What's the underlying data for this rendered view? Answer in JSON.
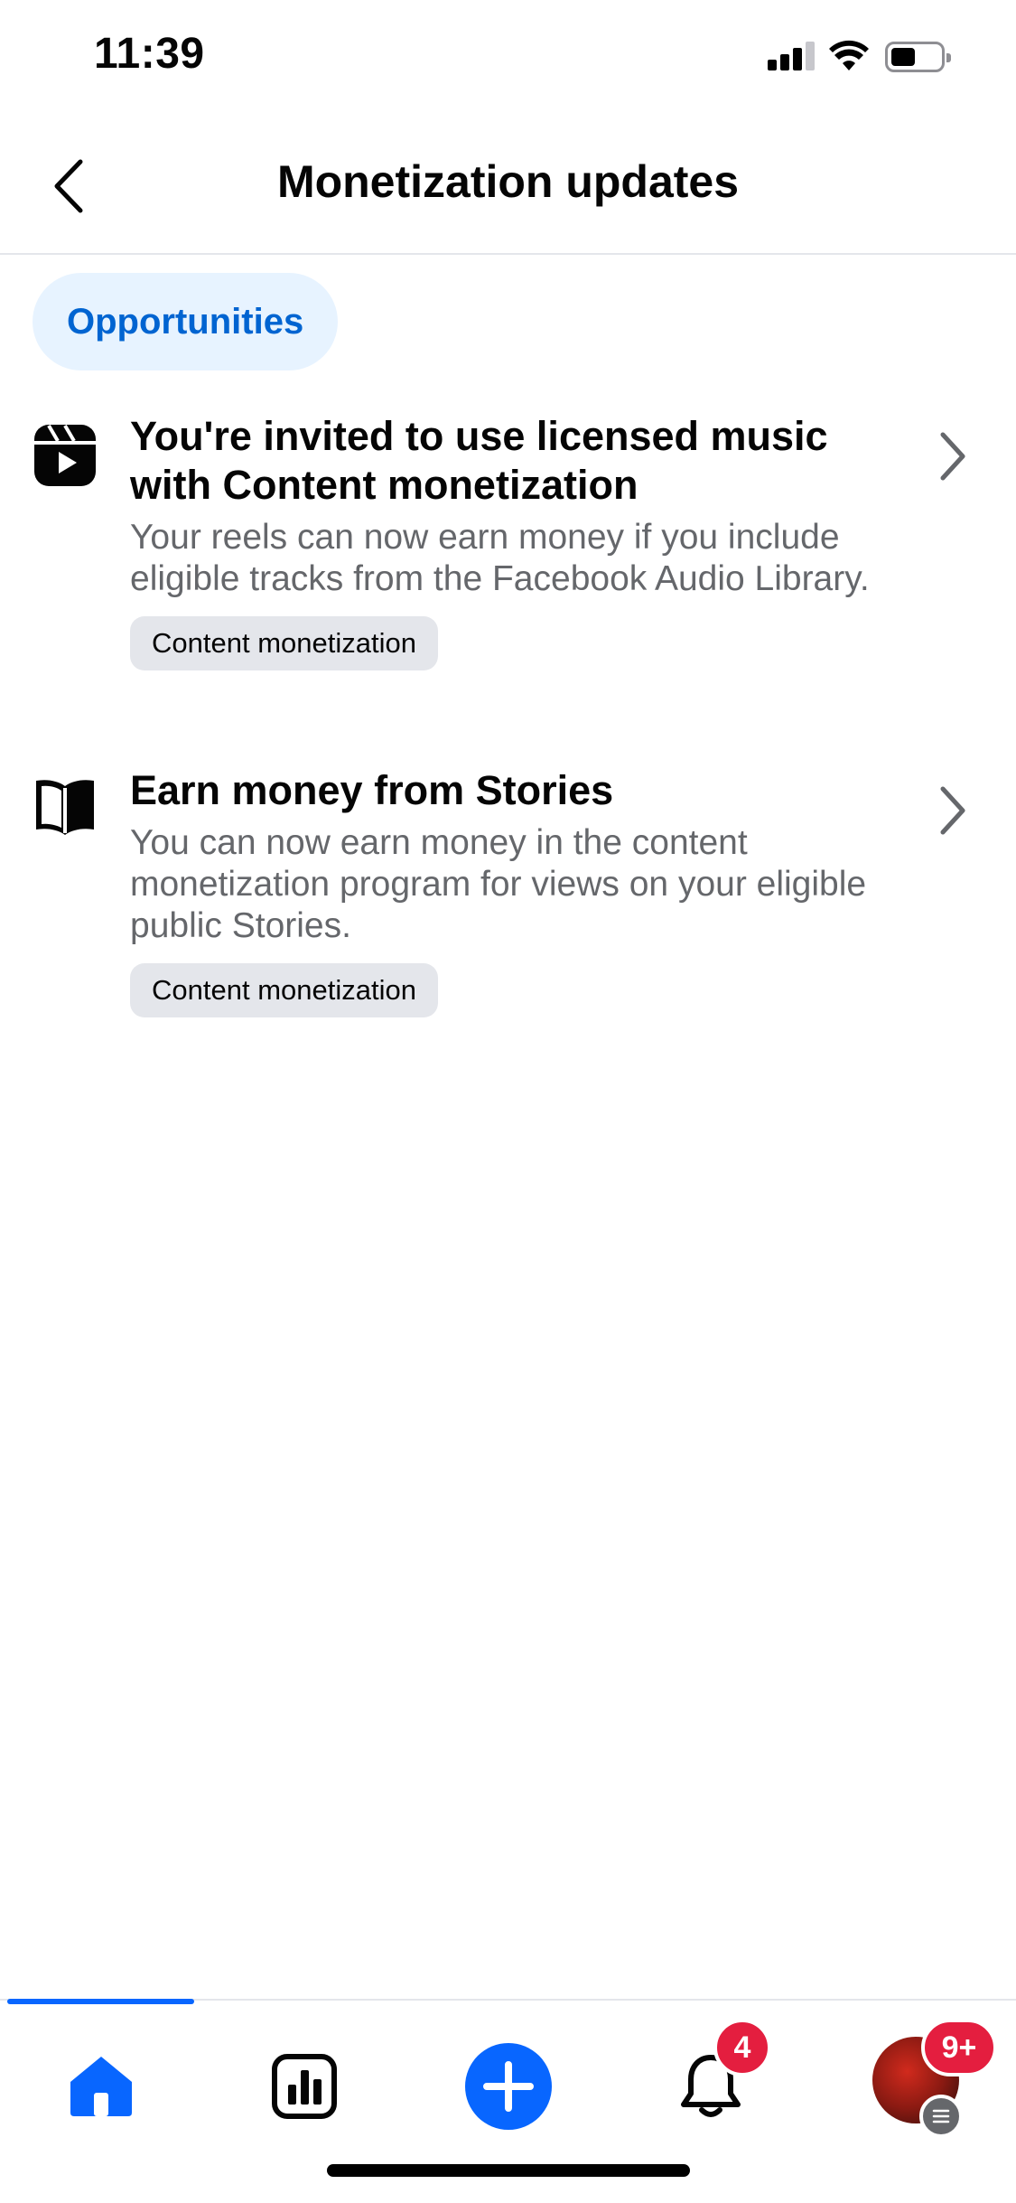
{
  "status_bar": {
    "time": "11:39"
  },
  "header": {
    "title": "Monetization updates",
    "back_icon": "chevron-left-icon"
  },
  "chip": {
    "label": "Opportunities"
  },
  "items": [
    {
      "icon": "reels-icon",
      "title": "You're invited to use licensed music with Content monetization",
      "description": "Your reels can now earn money if you include eligible tracks from the Facebook Audio Library.",
      "tag": "Content monetization"
    },
    {
      "icon": "book-icon",
      "title": "Earn money from Stories",
      "description": "You can now earn money in the content monetization program for views on your eligible public Stories.",
      "tag": "Content monetization"
    }
  ],
  "tabbar": {
    "active_color": "#0866ff",
    "notifications_badge": "4",
    "profile_badge": "9+"
  }
}
